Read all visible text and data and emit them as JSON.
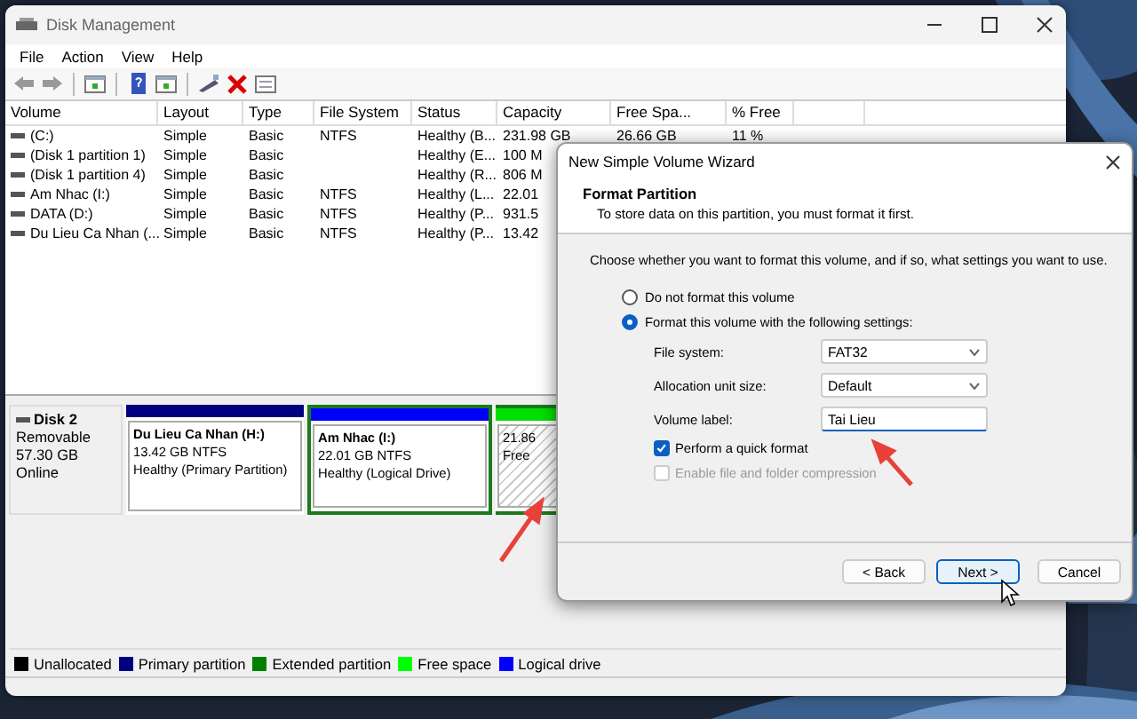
{
  "window": {
    "title": "Disk Management",
    "menu": [
      "File",
      "Action",
      "View",
      "Help"
    ]
  },
  "table": {
    "columns": [
      "Volume",
      "Layout",
      "Type",
      "File System",
      "Status",
      "Capacity",
      "Free Spa...",
      "% Free"
    ],
    "rows": [
      [
        "(C:)",
        "Simple",
        "Basic",
        "NTFS",
        "Healthy (B...",
        "231.98 GB",
        "26.66 GB",
        "11 %"
      ],
      [
        "(Disk 1 partition 1)",
        "Simple",
        "Basic",
        "",
        "Healthy (E...",
        "100 M",
        "",
        ""
      ],
      [
        "(Disk 1 partition 4)",
        "Simple",
        "Basic",
        "",
        "Healthy (R...",
        "806 M",
        "",
        ""
      ],
      [
        "Am Nhac (I:)",
        "Simple",
        "Basic",
        "NTFS",
        "Healthy (L...",
        "22.01",
        "",
        ""
      ],
      [
        "DATA (D:)",
        "Simple",
        "Basic",
        "NTFS",
        "Healthy (P...",
        "931.5",
        "",
        ""
      ],
      [
        "Du Lieu Ca Nhan (...",
        "Simple",
        "Basic",
        "NTFS",
        "Healthy (P...",
        "13.42",
        "",
        ""
      ]
    ]
  },
  "disk": {
    "name": "Disk 2",
    "type": "Removable",
    "size": "57.30 GB",
    "status": "Online",
    "partitions": [
      {
        "kind": "primary",
        "name": "Du Lieu Ca Nhan  (H:)",
        "size": "13.42 GB NTFS",
        "status": "Healthy (Primary Partition)"
      },
      {
        "kind": "logical",
        "name": "Am Nhac  (I:)",
        "size": "22.01 GB NTFS",
        "status": "Healthy (Logical Drive)"
      },
      {
        "kind": "free",
        "size": "21.86",
        "status": "Free"
      }
    ]
  },
  "legend": [
    {
      "label": "Unallocated",
      "color": "#000000"
    },
    {
      "label": "Primary partition",
      "color": "#000080"
    },
    {
      "label": "Extended partition",
      "color": "#008000"
    },
    {
      "label": "Free space",
      "color": "#00ff00"
    },
    {
      "label": "Logical drive",
      "color": "#0000ff"
    }
  ],
  "dialog": {
    "title": "New Simple Volume Wizard",
    "heading": "Format Partition",
    "subheading": "To store data on this partition, you must format it first.",
    "prompt": "Choose whether you want to format this volume, and if so, what settings you want to use.",
    "options": [
      {
        "label": "Do not format this volume",
        "selected": false
      },
      {
        "label": "Format this volume with the following settings:",
        "selected": true
      }
    ],
    "fields": [
      {
        "kind": "dropdown",
        "label": "File system:",
        "value": "FAT32"
      },
      {
        "kind": "dropdown",
        "label": "Allocation unit size:",
        "value": "Default"
      },
      {
        "kind": "text",
        "label": "Volume label:",
        "value": "Tai Lieu"
      }
    ],
    "checks": [
      {
        "label": "Perform a quick format",
        "checked": true,
        "disabled": false
      },
      {
        "label": "Enable file and folder compression",
        "checked": false,
        "disabled": true
      }
    ],
    "buttons": [
      {
        "label": "< Back",
        "selected": false
      },
      {
        "label": "Next >",
        "selected": true
      },
      {
        "label": "Cancel",
        "selected": false
      }
    ]
  }
}
